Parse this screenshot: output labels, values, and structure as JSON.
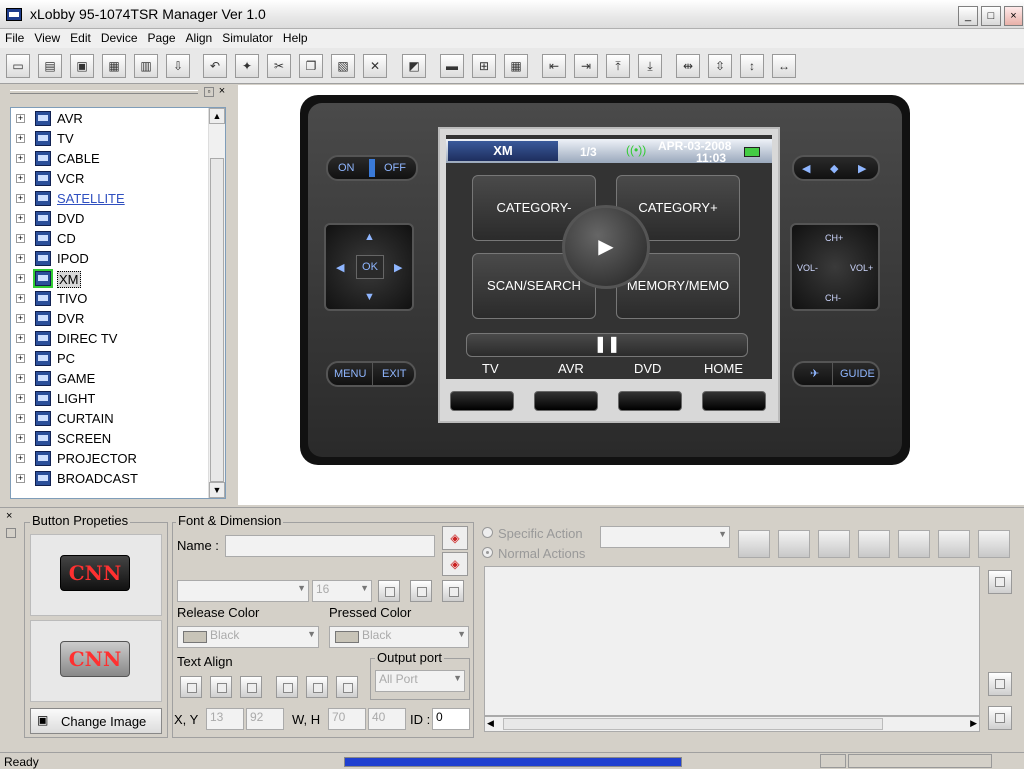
{
  "window": {
    "title": "xLobby 95-1074TSR Manager Ver 1.0"
  },
  "menu": [
    "File",
    "View",
    "Edit",
    "Device",
    "Page",
    "Align",
    "Simulator",
    "Help"
  ],
  "tree": {
    "items": [
      {
        "label": "AVR",
        "selected": false,
        "link": false
      },
      {
        "label": "TV",
        "selected": false,
        "link": false
      },
      {
        "label": "CABLE",
        "selected": false,
        "link": false
      },
      {
        "label": "VCR",
        "selected": false,
        "link": false
      },
      {
        "label": "SATELLITE",
        "selected": false,
        "link": true
      },
      {
        "label": "DVD",
        "selected": false,
        "link": false
      },
      {
        "label": "CD",
        "selected": false,
        "link": false
      },
      {
        "label": "IPOD",
        "selected": false,
        "link": false
      },
      {
        "label": "XM",
        "selected": true,
        "link": false
      },
      {
        "label": "TIVO",
        "selected": false,
        "link": false
      },
      {
        "label": "DVR",
        "selected": false,
        "link": false
      },
      {
        "label": "DIREC TV",
        "selected": false,
        "link": false
      },
      {
        "label": "PC",
        "selected": false,
        "link": false
      },
      {
        "label": "GAME",
        "selected": false,
        "link": false
      },
      {
        "label": "LIGHT",
        "selected": false,
        "link": false
      },
      {
        "label": "CURTAIN",
        "selected": false,
        "link": false
      },
      {
        "label": "SCREEN",
        "selected": false,
        "link": false
      },
      {
        "label": "PROJECTOR",
        "selected": false,
        "link": false
      },
      {
        "label": "BROADCAST",
        "selected": false,
        "link": false
      }
    ]
  },
  "remote": {
    "on": "ON",
    "off": "OFF",
    "ok": "OK",
    "menu": "MENU",
    "exit": "EXIT",
    "guide": "GUIDE",
    "ch_up": "CH+",
    "ch_down": "CH-",
    "vol_down": "VOL-",
    "vol_up": "VOL+",
    "screen": {
      "source": "XM",
      "page": "1/3",
      "date": "APR-03-2008",
      "time": "11:03",
      "btn_cat_minus": "CATEGORY-",
      "btn_cat_plus": "CATEGORY+",
      "btn_scan": "SCAN/SEARCH",
      "btn_memory": "MEMORY/MEMO",
      "nav": [
        "TV",
        "AVR",
        "DVD",
        "HOME"
      ]
    }
  },
  "props": {
    "button_props_title": "Button Propeties",
    "preview_label": "CNN",
    "change_image": "Change Image",
    "font_dim_title": "Font & Dimension",
    "name_label": "Name :",
    "name_value": "",
    "font_size": "16",
    "release_color_label": "Release Color",
    "release_color_value": "Black",
    "pressed_color_label": "Pressed Color",
    "pressed_color_value": "Black",
    "text_align_label": "Text Align",
    "output_port_label": "Output port",
    "output_port_value": "All Port",
    "xy_label": "X, Y",
    "x": "13",
    "y": "92",
    "wh_label": "W, H",
    "w": "70",
    "h": "40",
    "id_label": "ID :",
    "id_value": "0"
  },
  "actions": {
    "specific": "Specific Action",
    "normal": "Normal Actions"
  },
  "status": {
    "text": "Ready"
  }
}
